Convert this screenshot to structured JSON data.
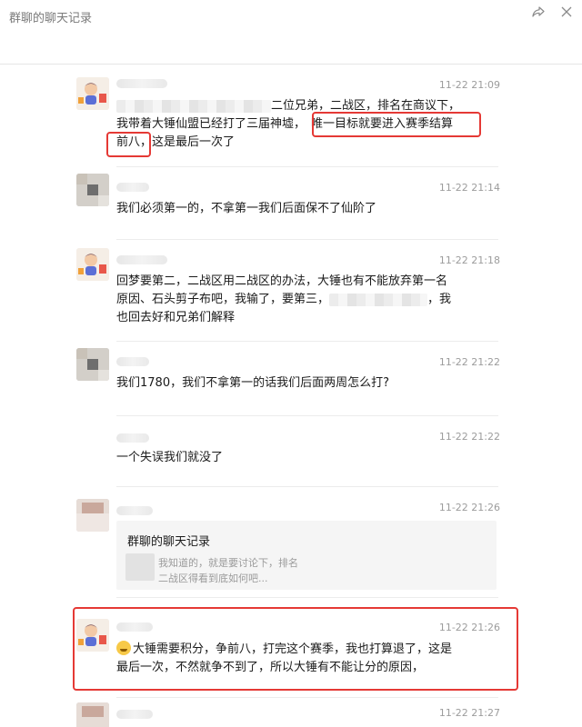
{
  "window": {
    "title": "群聊的聊天记录"
  },
  "messages": [
    {
      "time": "11-22 21:09",
      "line1_tail": "二位兄弟，二战区，排名在商议下，",
      "line2_a": "我带着大锤仙盟已经打了三届神墟，",
      "line2_hl": "唯一目标就要进入赛季结算",
      "line3_hl": "前八",
      "line3_rest": "，这是最后一次了"
    },
    {
      "time": "11-22 21:14",
      "text": "我们必须第一的，不拿第一我们后面保不了仙阶了"
    },
    {
      "time": "11-22 21:18",
      "line1": "回梦要第二，二战区用二战区的办法，大锤也有不能放弃第一名",
      "line2_a": "原因、石头剪子布吧，我输了，要第三，",
      "line2_b": "，我",
      "line3": "也回去好和兄弟们解释"
    },
    {
      "time": "11-22 21:22",
      "text": "我们1780，我们不拿第一的话我们后面两周怎么打?"
    },
    {
      "time": "11-22 21:22",
      "text": "一个失误我们就没了"
    },
    {
      "time": "11-22 21:26",
      "quote_title": "群聊的聊天记录",
      "quote_line1": "我知道的，就是要讨论下，排名",
      "quote_line2": "二战区得看到底如何吧..."
    },
    {
      "time": "11-22 21:26",
      "line1": "大锤需要积分，争前八，打完这个赛季，我也打算退了，这是",
      "line2": "最后一次，不然就争不到了，所以大锤有不能让分的原因，"
    },
    {
      "time": "11-22 21:27"
    }
  ],
  "icons": [
    "share-icon",
    "close-icon",
    "emoji-icon"
  ],
  "colors": {
    "highlight": "#e53935",
    "time": "#9c9c9c",
    "quote_bg": "#f5f5f5"
  }
}
